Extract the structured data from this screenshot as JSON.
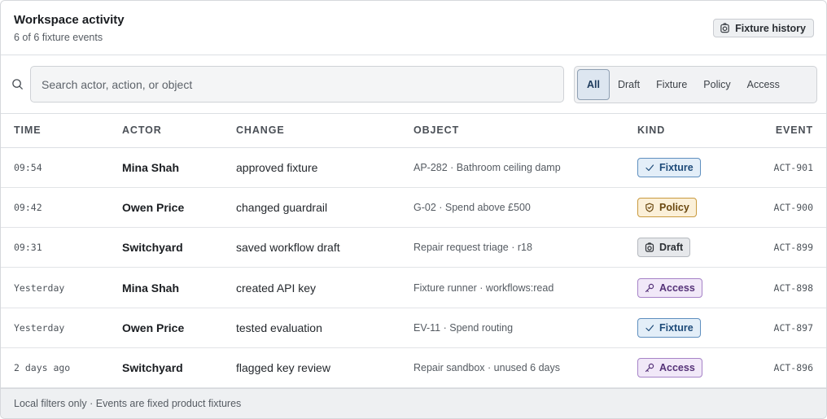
{
  "header": {
    "title": "Workspace activity",
    "subtitle": "6 of 6 fixture events",
    "history_button": "Fixture history"
  },
  "search": {
    "placeholder": "Search actor, action, or object",
    "value": ""
  },
  "filters": [
    {
      "label": "All",
      "active": true
    },
    {
      "label": "Draft",
      "active": false
    },
    {
      "label": "Fixture",
      "active": false
    },
    {
      "label": "Policy",
      "active": false
    },
    {
      "label": "Access",
      "active": false
    }
  ],
  "table": {
    "columns": {
      "time": "TIME",
      "actor": "ACTOR",
      "change": "CHANGE",
      "object": "OBJECT",
      "kind": "KIND",
      "event": "EVENT"
    },
    "rows": [
      {
        "time": "09:54",
        "actor": "Mina Shah",
        "change": "approved fixture",
        "object": "AP-282 · Bathroom ceiling damp",
        "kind": "Fixture",
        "kind_icon": "check-icon",
        "event": "ACT-901"
      },
      {
        "time": "09:42",
        "actor": "Owen Price",
        "change": "changed guardrail",
        "object": "G-02 · Spend above £500",
        "kind": "Policy",
        "kind_icon": "shield-icon",
        "event": "ACT-900"
      },
      {
        "time": "09:31",
        "actor": "Switchyard",
        "change": "saved workflow draft",
        "object": "Repair request triage · r18",
        "kind": "Draft",
        "kind_icon": "draft-icon",
        "event": "ACT-899"
      },
      {
        "time": "Yesterday",
        "actor": "Mina Shah",
        "change": "created API key",
        "object": "Fixture runner · workflows:read",
        "kind": "Access",
        "kind_icon": "key-icon",
        "event": "ACT-898"
      },
      {
        "time": "Yesterday",
        "actor": "Owen Price",
        "change": "tested evaluation",
        "object": "EV-11 · Spend routing",
        "kind": "Fixture",
        "kind_icon": "check-icon",
        "event": "ACT-897"
      },
      {
        "time": "2 days ago",
        "actor": "Switchyard",
        "change": "flagged key review",
        "object": "Repair sandbox · unused 6 days",
        "kind": "Access",
        "kind_icon": "key-icon",
        "event": "ACT-896"
      }
    ]
  },
  "footer": {
    "text": "Local filters only · Events are fixed product fixtures"
  },
  "colors": {
    "fixture": "#1d4a78",
    "policy": "#6a4810",
    "draft": "#2c3035",
    "access": "#553278",
    "active_filter": "#dde6f0"
  }
}
